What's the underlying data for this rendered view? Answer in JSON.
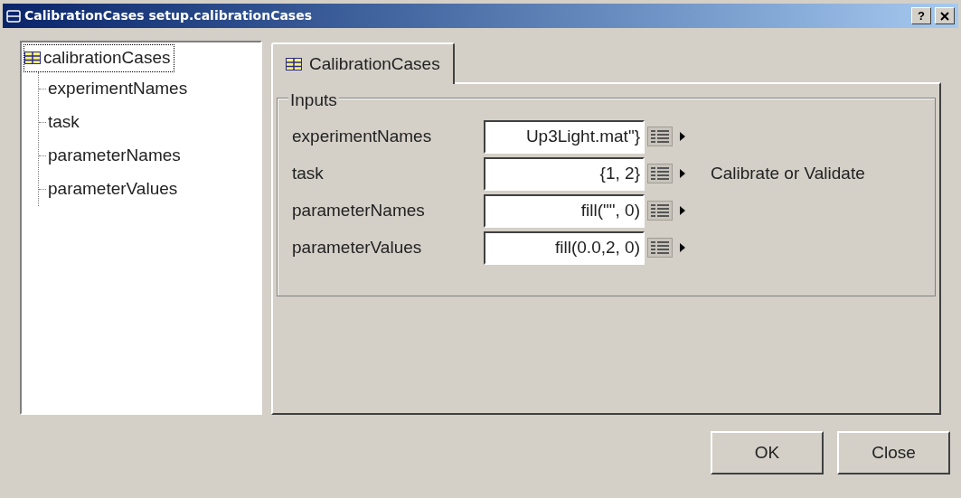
{
  "window": {
    "title": "CalibrationCases setup.calibrationCases",
    "buttons": [
      "?"
    ]
  },
  "tree": {
    "root": {
      "label": "calibrationCases",
      "selected": true
    },
    "children": [
      {
        "label": "experimentNames",
        "selected": false
      },
      {
        "label": "task",
        "selected": false
      },
      {
        "label": "parameterNames",
        "selected": false
      },
      {
        "label": "parameterValues",
        "selected": false
      }
    ]
  },
  "tabs": [
    {
      "label": "CalibrationCases",
      "selected": true
    }
  ],
  "group": {
    "title": "Inputs",
    "rows": [
      {
        "label": "experimentNames",
        "value": "Up3Light.mat\"}"
      },
      {
        "label": "task",
        "value": "{1, 2}",
        "note": "Calibrate or Validate"
      },
      {
        "label": "parameterNames",
        "value": "fill(\"\", 0)"
      },
      {
        "label": "parameterValues",
        "value": "fill(0.0,2, 0)"
      }
    ]
  },
  "buttons": [
    "OK",
    "Close"
  ]
}
